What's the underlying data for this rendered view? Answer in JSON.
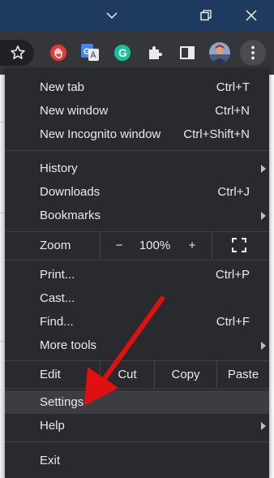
{
  "titlebar": {
    "controls": [
      "chevron-down-icon",
      "restore-icon",
      "close-icon"
    ]
  },
  "toolbar": {
    "icons": [
      "bookmark-star-icon",
      "extension-stop-icon",
      "google-translate-icon",
      "grammarly-icon",
      "extensions-puzzle-icon",
      "side-panel-icon",
      "profile-avatar-icon",
      "more-menu-icon"
    ],
    "google_translate_letter": "G",
    "grammarly_letter": "G"
  },
  "colors": {
    "menu_bg": "#292a2d",
    "highlight": "#3c3d41",
    "text": "#e8eaed",
    "annotation_arrow": "#e01010"
  },
  "menu": {
    "new_tab": {
      "label": "New tab",
      "shortcut": "Ctrl+T"
    },
    "new_window": {
      "label": "New window",
      "shortcut": "Ctrl+N"
    },
    "new_incognito": {
      "label": "New Incognito window",
      "shortcut": "Ctrl+Shift+N"
    },
    "history": {
      "label": "History"
    },
    "downloads": {
      "label": "Downloads",
      "shortcut": "Ctrl+J"
    },
    "bookmarks": {
      "label": "Bookmarks"
    },
    "zoom": {
      "label": "Zoom",
      "minus": "−",
      "level": "100%",
      "plus": "+"
    },
    "print": {
      "label": "Print...",
      "shortcut": "Ctrl+P"
    },
    "cast": {
      "label": "Cast..."
    },
    "find": {
      "label": "Find...",
      "shortcut": "Ctrl+F"
    },
    "more_tools": {
      "label": "More tools"
    },
    "edit": {
      "label": "Edit",
      "cut": "Cut",
      "copy": "Copy",
      "paste": "Paste"
    },
    "settings": {
      "label": "Settings"
    },
    "help": {
      "label": "Help"
    },
    "exit": {
      "label": "Exit"
    }
  }
}
